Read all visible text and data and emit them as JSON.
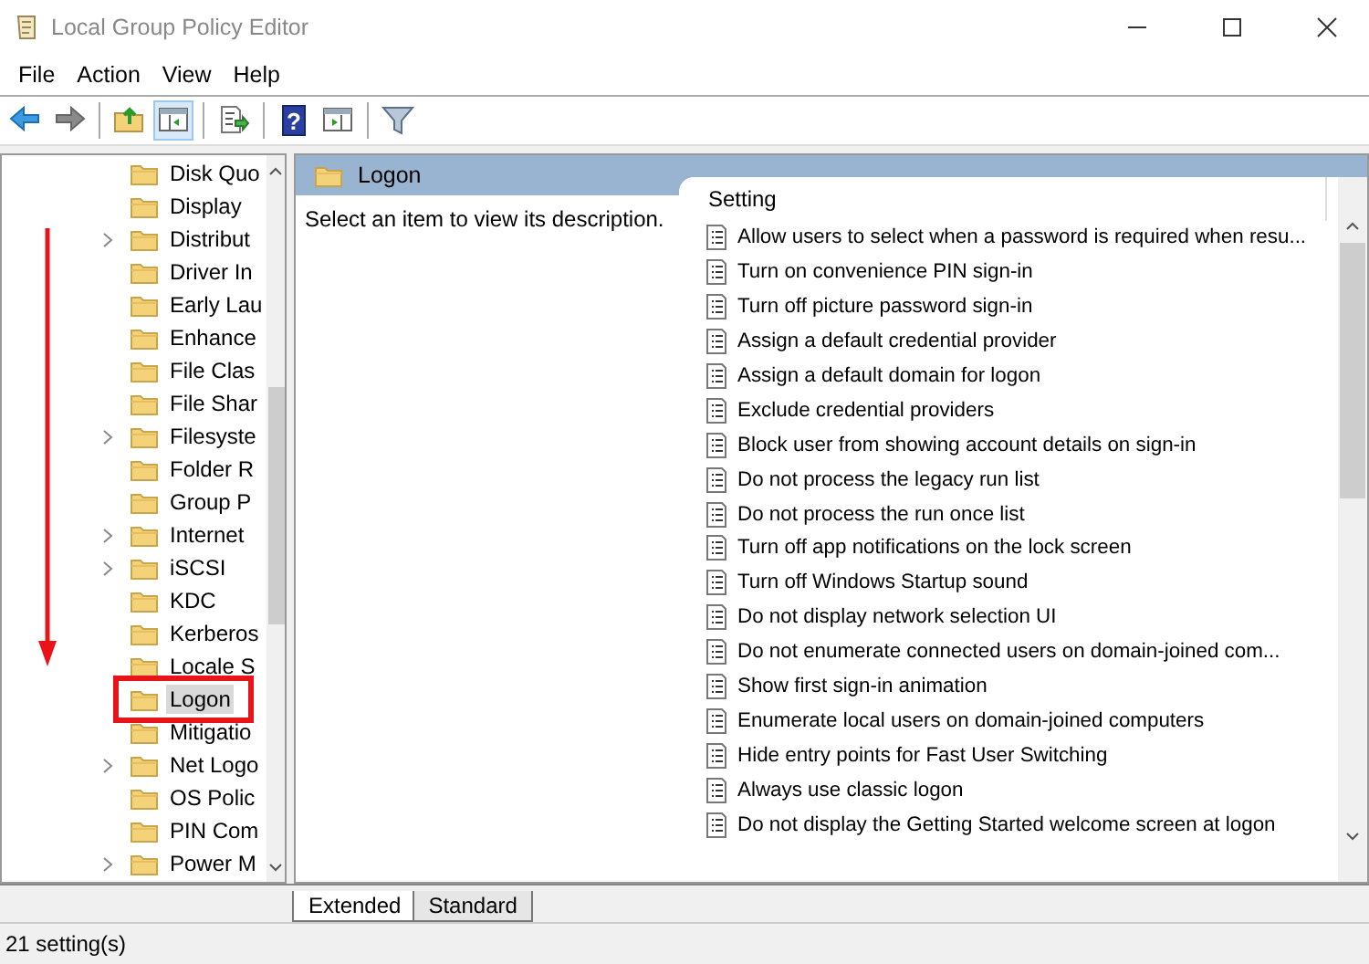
{
  "window": {
    "title": "Local Group Policy Editor"
  },
  "menu": [
    "File",
    "Action",
    "View",
    "Help"
  ],
  "toolbar": [
    {
      "kind": "back",
      "pressed": false
    },
    {
      "kind": "forward",
      "pressed": false
    },
    {
      "kind": "sep"
    },
    {
      "kind": "up",
      "pressed": false
    },
    {
      "kind": "tree",
      "pressed": true
    },
    {
      "kind": "sep"
    },
    {
      "kind": "export",
      "pressed": false
    },
    {
      "kind": "sep"
    },
    {
      "kind": "help",
      "pressed": false,
      "glyph": "?"
    },
    {
      "kind": "console",
      "pressed": false
    },
    {
      "kind": "sep"
    },
    {
      "kind": "filter",
      "pressed": false
    }
  ],
  "tree": {
    "items": [
      {
        "label": "Disk Quo",
        "expandable": false,
        "selected": false
      },
      {
        "label": "Display",
        "expandable": false,
        "selected": false
      },
      {
        "label": "Distribut",
        "expandable": true,
        "selected": false
      },
      {
        "label": "Driver In",
        "expandable": false,
        "selected": false
      },
      {
        "label": "Early Lau",
        "expandable": false,
        "selected": false
      },
      {
        "label": "Enhance",
        "expandable": false,
        "selected": false
      },
      {
        "label": "File Clas",
        "expandable": false,
        "selected": false
      },
      {
        "label": "File Shar",
        "expandable": false,
        "selected": false
      },
      {
        "label": "Filesyste",
        "expandable": true,
        "selected": false
      },
      {
        "label": "Folder R",
        "expandable": false,
        "selected": false
      },
      {
        "label": "Group P",
        "expandable": false,
        "selected": false
      },
      {
        "label": "Internet",
        "expandable": true,
        "selected": false
      },
      {
        "label": "iSCSI",
        "expandable": true,
        "selected": false
      },
      {
        "label": "KDC",
        "expandable": false,
        "selected": false
      },
      {
        "label": "Kerberos",
        "expandable": false,
        "selected": false
      },
      {
        "label": "Locale S",
        "expandable": false,
        "selected": false
      },
      {
        "label": "Logon",
        "expandable": false,
        "selected": true
      },
      {
        "label": "Mitigatio",
        "expandable": false,
        "selected": false
      },
      {
        "label": "Net Logo",
        "expandable": true,
        "selected": false
      },
      {
        "label": "OS Polic",
        "expandable": false,
        "selected": false
      },
      {
        "label": "PIN Com",
        "expandable": false,
        "selected": false
      },
      {
        "label": "Power M",
        "expandable": true,
        "selected": false
      }
    ]
  },
  "details": {
    "title": "Logon",
    "description": "Select an item to view its description.",
    "column": "Setting",
    "settings": [
      "Allow users to select when a password is required when resu...",
      "Turn on convenience PIN sign-in",
      "Turn off picture password sign-in",
      "Assign a default credential provider",
      "Assign a default domain for logon",
      "Exclude credential providers",
      "Block user from showing account details on sign-in",
      "Do not process the legacy run list",
      "Do not process the run once list",
      "Turn off app notifications on the lock screen",
      "Turn off Windows Startup sound",
      "Do not display network selection UI",
      "Do not enumerate connected users on domain-joined com...",
      "Show first sign-in animation",
      "Enumerate local users on domain-joined computers",
      "Hide entry points for Fast User Switching",
      "Always use classic logon",
      "Do not display the Getting Started welcome screen at logon"
    ]
  },
  "tabs": [
    {
      "label": "Extended",
      "selected": true
    },
    {
      "label": "Standard",
      "selected": false
    }
  ],
  "status_bar": "21 setting(s)"
}
